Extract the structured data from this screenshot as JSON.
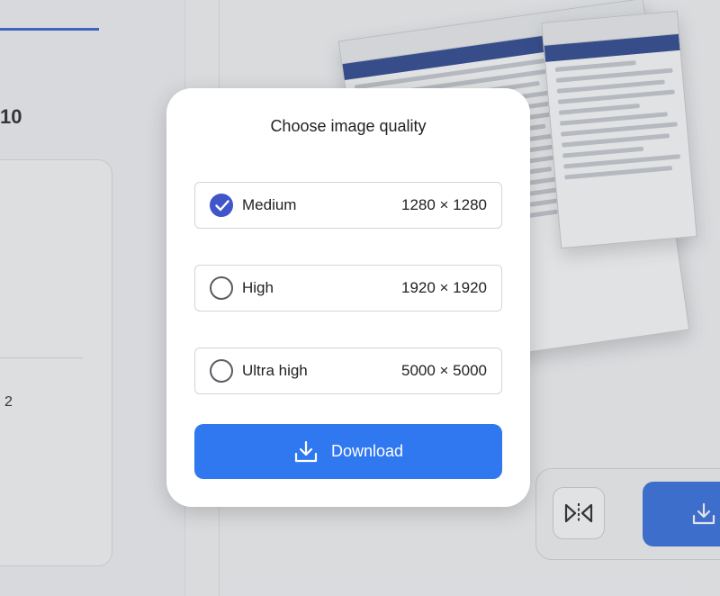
{
  "background": {
    "number_10": "10",
    "number_2": "2"
  },
  "dialog": {
    "title": "Choose image quality",
    "options": [
      {
        "label": "Medium",
        "resolution": "1280 × 1280",
        "selected": true
      },
      {
        "label": "High",
        "resolution": "1920 × 1920",
        "selected": false
      },
      {
        "label": "Ultra high",
        "resolution": "5000 × 5000",
        "selected": false
      }
    ],
    "download_label": "Download"
  },
  "icons": {
    "check": "check-icon",
    "download": "download-icon",
    "flip": "flip-horizontal-icon"
  },
  "colors": {
    "accent": "#2f78f0",
    "radio_checked": "#3f55c9"
  }
}
